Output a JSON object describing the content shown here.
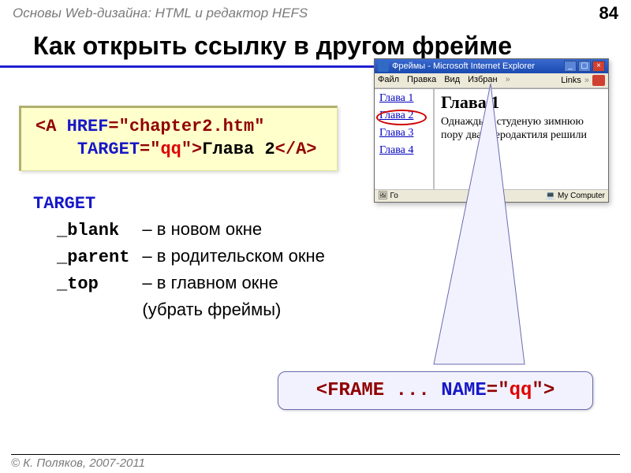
{
  "header": {
    "breadcrumb": "Основы Web-дизайна: HTML и редактор HEFS",
    "page_number": "84"
  },
  "title": "Как открыть ссылку в другом фрейме",
  "code": {
    "a_open": "<A ",
    "href_attr": "HREF",
    "href_val": "=\"chapter2.htm\"",
    "target_attr": "TARGET",
    "eq_quote": "=\"",
    "target_val": "qq",
    "close_quote": "\">",
    "link_text": "Глава 2",
    "a_close": "</A>"
  },
  "target": {
    "keyword": "TARGET",
    "rows": [
      {
        "attr": "_blank",
        "desc": "– в новом окне"
      },
      {
        "attr": "_parent",
        "desc": "– в родительском окне"
      },
      {
        "attr": "_top",
        "desc": "– в главном окне"
      }
    ],
    "extra": "(убрать фреймы)"
  },
  "browser": {
    "title": "Фреймы - Microsoft Internet Explorer",
    "menu": [
      "Файл",
      "Правка",
      "Вид",
      "Избран"
    ],
    "links_label": "Links",
    "left_links": [
      "Глава 1",
      "Глава 2",
      "Глава 3",
      "Глава 4"
    ],
    "right_heading": "Глава 1",
    "right_text": "Однажды в студеную зимнюю пору два птеродактиля решили",
    "status_left": "Го",
    "status_right": "My Computer"
  },
  "callout": {
    "frame_open": "<FRAME ... ",
    "name_attr": "NAME",
    "eq_quote": "=\"",
    "name_val": "qq",
    "close": "\">"
  },
  "footer": "© К. Поляков, 2007-2011"
}
